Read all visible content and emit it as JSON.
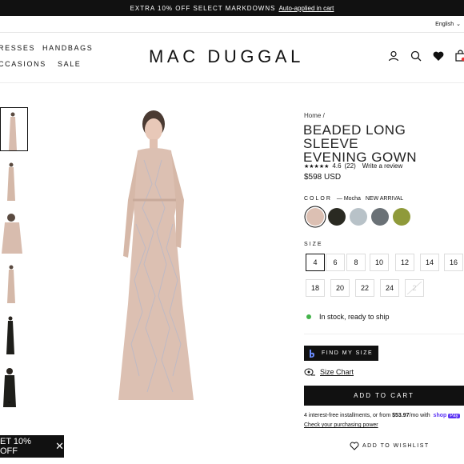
{
  "promo_bar": {
    "text": "EXTRA 10% OFF SELECT MARKDOWNS",
    "link": "Auto-applied in cart"
  },
  "language": "English",
  "nav": {
    "left_items": [
      "RESSES",
      "HANDBAGS",
      "CCASIONS",
      "SALE"
    ]
  },
  "logo": "MAC DUGGAL",
  "header_icons": [
    "user-icon",
    "search-icon",
    "heart-icon",
    "cart-icon"
  ],
  "gallery": {
    "thumbnails": 6,
    "active_index": 0,
    "scroll": "chevron-down-icon"
  },
  "product": {
    "breadcrumb": "Home /",
    "title_line1": "BEADED LONG SLEEVE",
    "title_line2": "EVENING GOWN",
    "stars": "★★★★★",
    "rating": "4.6",
    "review_count": "(22)",
    "write_review": "Write a review",
    "price": "$598 USD",
    "color_label": "COLOR",
    "color_value": "— Mocha",
    "badge": "NEW ARRIVAL",
    "swatches": [
      {
        "name": "mocha",
        "color": "#dcc0b3",
        "selected": true
      },
      {
        "name": "black-gold",
        "color": "#2a2a22",
        "selected": false
      },
      {
        "name": "silver",
        "color": "#b8c2c8",
        "selected": false
      },
      {
        "name": "charcoal",
        "color": "#6a7176",
        "selected": false
      },
      {
        "name": "olive",
        "color": "#8f9a3a",
        "selected": false
      }
    ],
    "size_label": "SIZE",
    "sizes": [
      {
        "label": "4",
        "selected": true,
        "available": true
      },
      {
        "label": "6",
        "selected": false,
        "available": true
      },
      {
        "label": "8",
        "selected": false,
        "available": true
      },
      {
        "label": "10",
        "selected": false,
        "available": true
      },
      {
        "label": "12",
        "selected": false,
        "available": true
      },
      {
        "label": "14",
        "selected": false,
        "available": true
      },
      {
        "label": "16",
        "selected": false,
        "available": true
      },
      {
        "label": "18",
        "selected": false,
        "available": true
      },
      {
        "label": "20",
        "selected": false,
        "available": true
      },
      {
        "label": "22",
        "selected": false,
        "available": true
      },
      {
        "label": "24",
        "selected": false,
        "available": true
      },
      {
        "label": "2",
        "selected": false,
        "available": false
      }
    ],
    "stock": "In stock, ready to ship",
    "find_size": "FIND MY SIZE",
    "size_chart": "Size Chart",
    "add_to_cart": "ADD TO CART",
    "installments_prefix": "4 interest-free installments, or from",
    "installments_amount": "$53.97",
    "installments_suffix": "/mo with",
    "shop_label": "shop",
    "pay_label": "Pay",
    "check_power": "Check your purchasing power",
    "wishlist": "ADD TO WISHLIST"
  },
  "popup": {
    "text": "ET 10% OFF"
  },
  "colors": {
    "accent": "#111111",
    "in_stock": "#44b34a",
    "shop_pay": "#5a31f4"
  }
}
